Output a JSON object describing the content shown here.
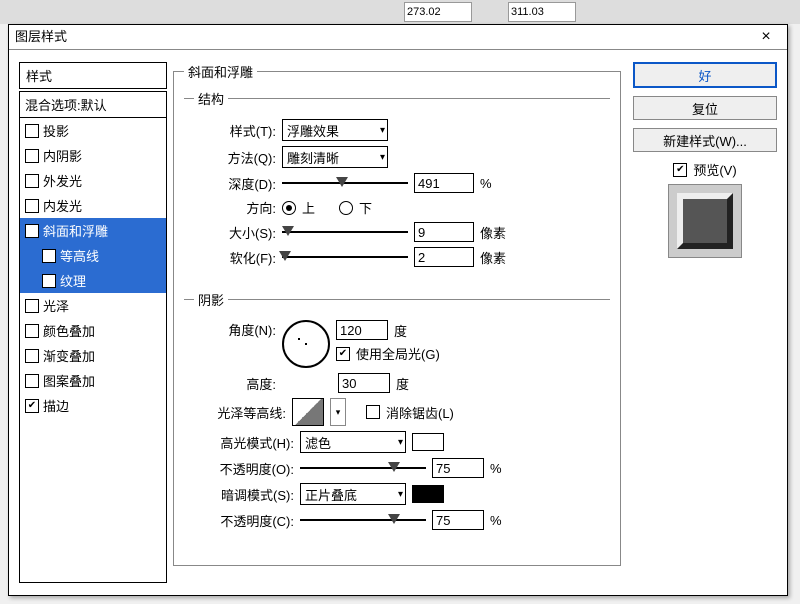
{
  "topTools": {
    "field1": "273.02",
    "field2": "311.03"
  },
  "dialog": {
    "title": "图层样式",
    "styleHeader": "样式",
    "blendOptions": "混合选项:默认",
    "effects": {
      "dropShadow": "投影",
      "innerShadow": "内阴影",
      "outerGlow": "外发光",
      "innerGlow": "内发光",
      "bevel": "斜面和浮雕",
      "contour": "等高线",
      "texture": "纹理",
      "satin": "光泽",
      "colorOverlay": "颜色叠加",
      "gradientOverlay": "渐变叠加",
      "patternOverlay": "图案叠加",
      "stroke": "描边"
    },
    "bevelGroup": {
      "title": "斜面和浮雕",
      "structureTitle": "结构",
      "styleLabel": "样式(T):",
      "styleValue": "浮雕效果",
      "methodLabel": "方法(Q):",
      "methodValue": "雕刻清晰",
      "depthLabel": "深度(D):",
      "depthValue": "491",
      "percent": "%",
      "directionLabel": "方向:",
      "up": "上",
      "down": "下",
      "sizeLabel": "大小(S):",
      "sizeValue": "9",
      "px": "像素",
      "softenLabel": "软化(F):",
      "softenValue": "2"
    },
    "shadowGroup": {
      "title": "阴影",
      "angleLabel": "角度(N):",
      "angleValue": "120",
      "deg": "度",
      "globalLight": "使用全局光(G)",
      "altitudeLabel": "高度:",
      "altitudeValue": "30",
      "glossContourLabel": "光泽等高线:",
      "antiAlias": "消除锯齿(L)",
      "highlightModeLabel": "高光模式(H):",
      "highlightModeValue": "滤色",
      "highlightOpacityLabel": "不透明度(O):",
      "highlightOpacityValue": "75",
      "shadowModeLabel": "暗调模式(S):",
      "shadowModeValue": "正片叠底",
      "shadowOpacityLabel": "不透明度(C):",
      "shadowOpacityValue": "75"
    },
    "buttons": {
      "ok": "好",
      "reset": "复位",
      "newStyle": "新建样式(W)...",
      "preview": "预览(V)"
    },
    "colors": {
      "highlight": "#ffffff",
      "shadow": "#000000"
    }
  }
}
